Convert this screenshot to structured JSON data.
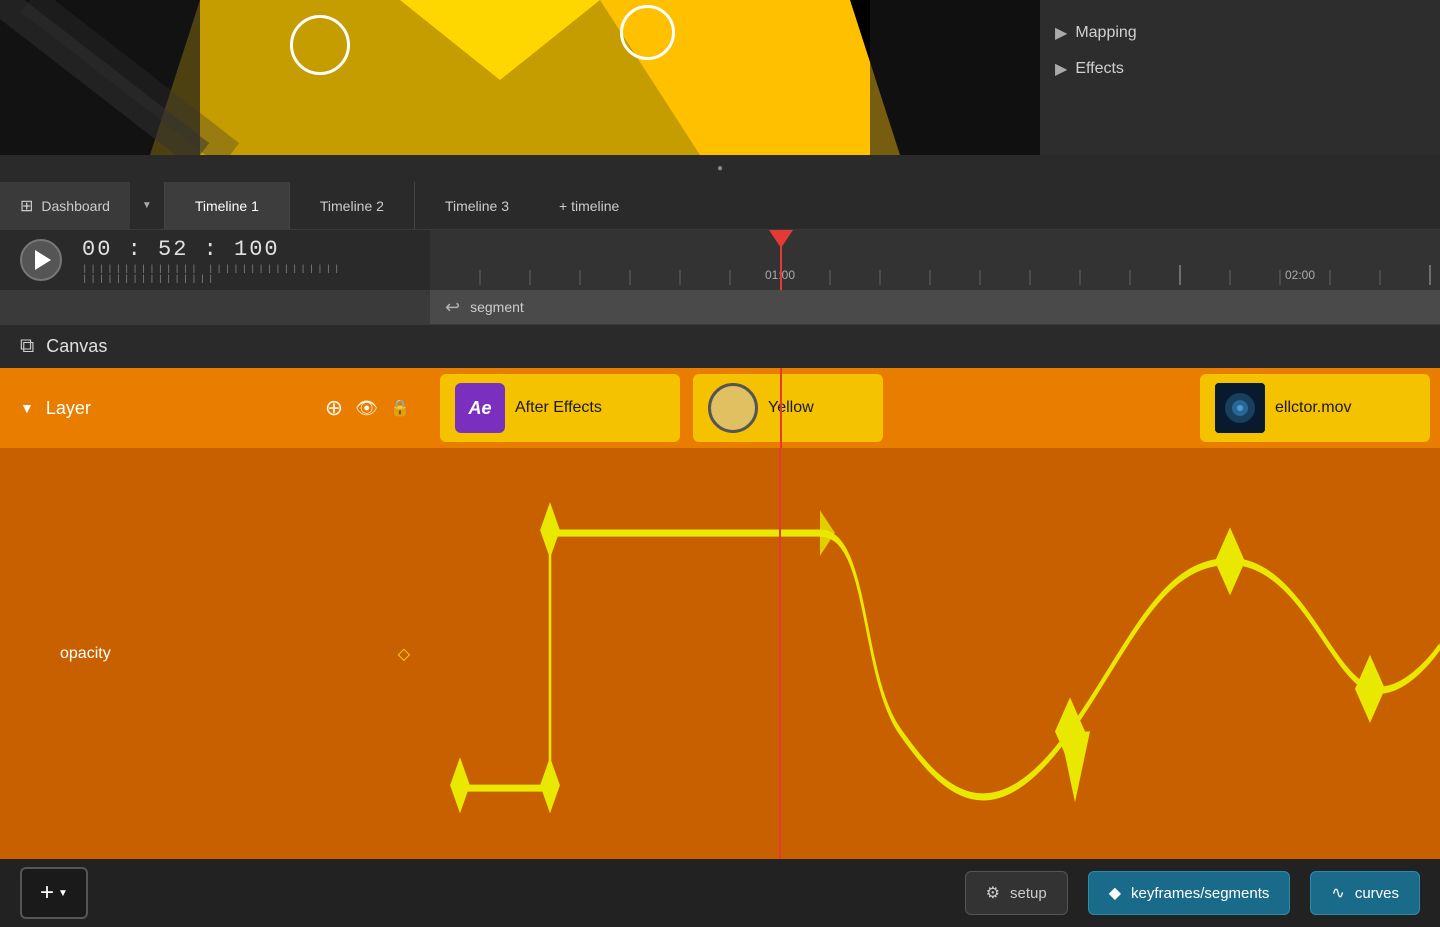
{
  "preview": {
    "right_panel": {
      "mapping_label": "Mapping",
      "effects_label": "Effects"
    }
  },
  "tabs": {
    "dashboard_label": "Dashboard",
    "timeline1_label": "Timeline 1",
    "timeline2_label": "Timeline 2",
    "timeline3_label": "Timeline 3",
    "add_label": "+ timeline"
  },
  "transport": {
    "time_hours": "00",
    "time_minutes": "52",
    "time_frames": "100",
    "play_label": "play"
  },
  "ruler": {
    "marker1": "01:00",
    "marker2": "02:00"
  },
  "segment": {
    "label": "segment"
  },
  "canvas": {
    "title": "Canvas"
  },
  "layer": {
    "title": "Layer",
    "clips": [
      {
        "type": "ae",
        "label": "After Effects"
      },
      {
        "type": "yellow",
        "label": "Yellow"
      },
      {
        "type": "mov",
        "label": "ellctor.mov"
      }
    ]
  },
  "opacity": {
    "label": "opacity"
  },
  "toolbar": {
    "setup_label": "setup",
    "keyframes_label": "keyframes/segments",
    "curves_label": "curves"
  }
}
